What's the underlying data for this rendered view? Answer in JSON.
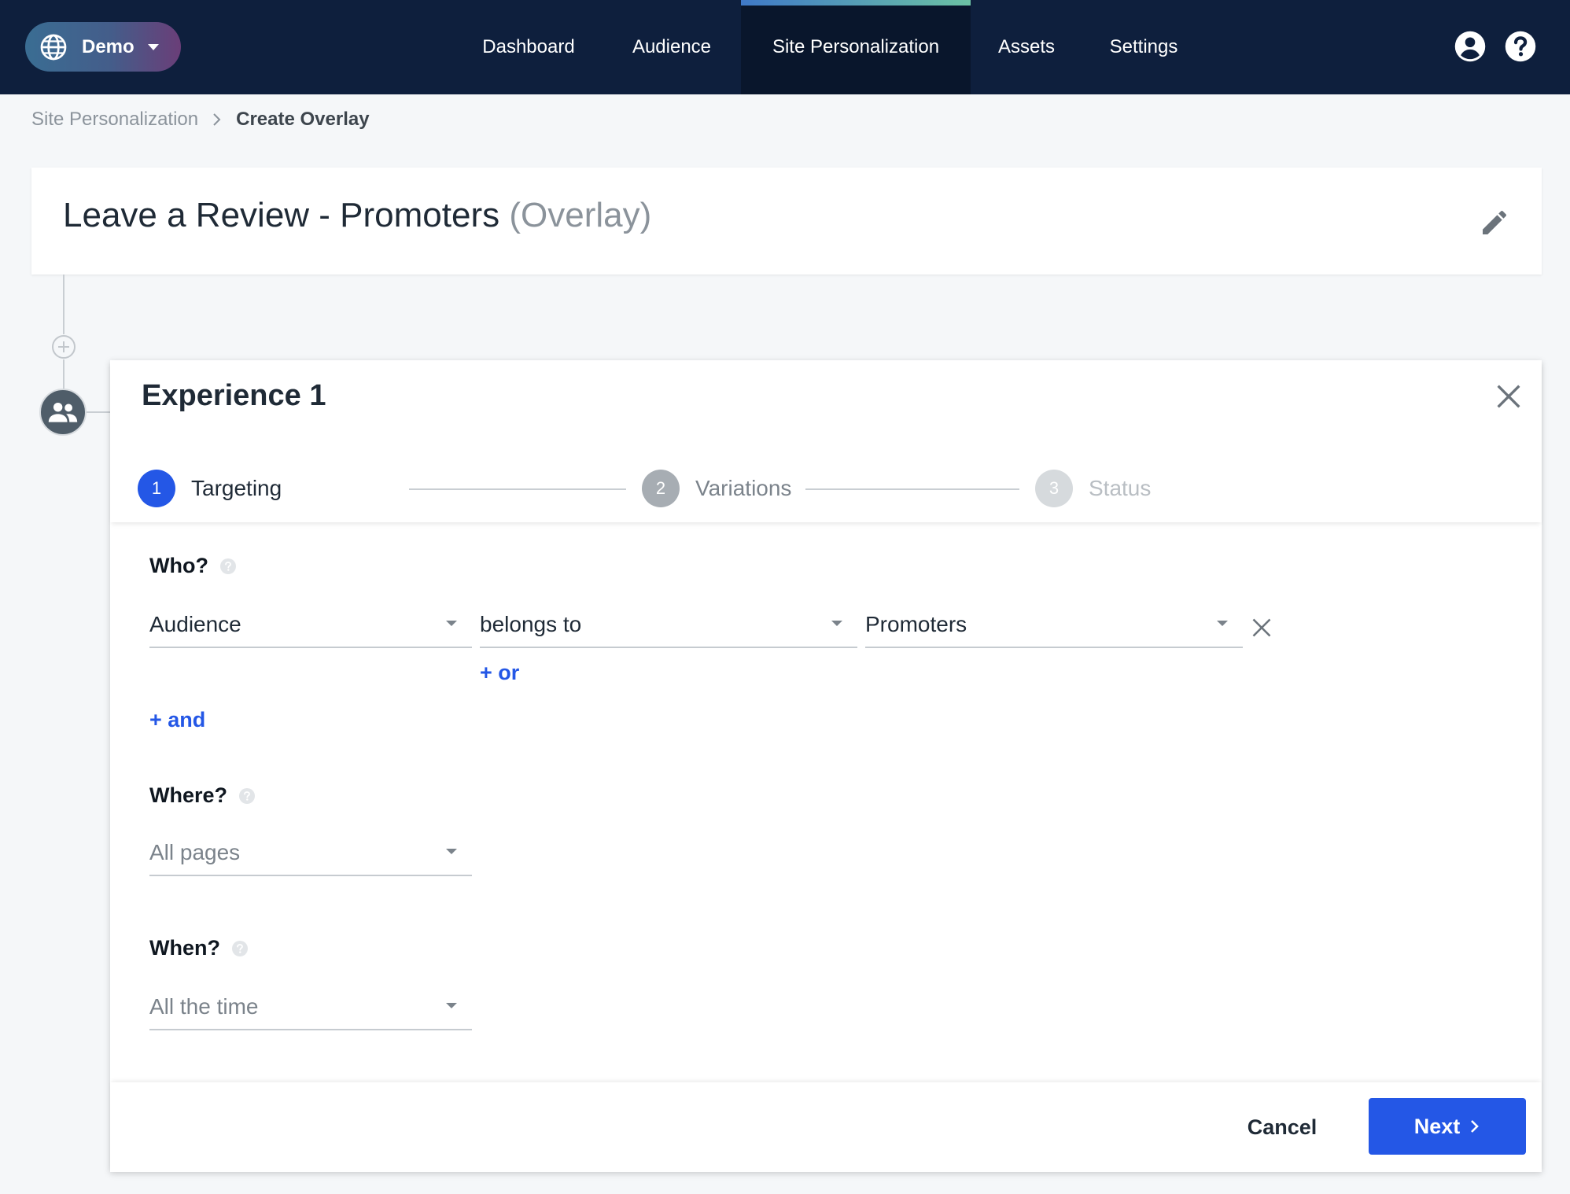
{
  "org_switcher": {
    "label": "Demo",
    "icon": "globe-icon"
  },
  "nav": {
    "items": [
      {
        "label": "Dashboard",
        "active": false
      },
      {
        "label": "Audience",
        "active": false
      },
      {
        "label": "Site Personalization",
        "active": true
      },
      {
        "label": "Assets",
        "active": false
      },
      {
        "label": "Settings",
        "active": false
      }
    ],
    "icons": [
      "account-icon",
      "help-icon"
    ]
  },
  "breadcrumb": {
    "parent": "Site Personalization",
    "current": "Create Overlay"
  },
  "campaign": {
    "name": "Leave a Review - Promoters",
    "type": "(Overlay)"
  },
  "experience": {
    "title": "Experience 1",
    "steps": [
      {
        "number": "1",
        "label": "Targeting",
        "state": "active"
      },
      {
        "number": "2",
        "label": "Variations",
        "state": "pending"
      },
      {
        "number": "3",
        "label": "Status",
        "state": "disabled"
      }
    ],
    "who": {
      "title": "Who?",
      "condition": {
        "field": "Audience",
        "operator": "belongs to",
        "value": "Promoters"
      },
      "add_or": "+ or",
      "add_and": "+ and"
    },
    "where": {
      "title": "Where?",
      "value": "All pages"
    },
    "when": {
      "title": "When?",
      "value": "All the time"
    }
  },
  "footer": {
    "cancel_label": "Cancel",
    "next_label": "Next"
  },
  "colors": {
    "nav_bg": "#0e1f3d",
    "primary": "#2457e6",
    "step_inactive": "#a7adb3",
    "step_disabled": "#d6dadd"
  }
}
